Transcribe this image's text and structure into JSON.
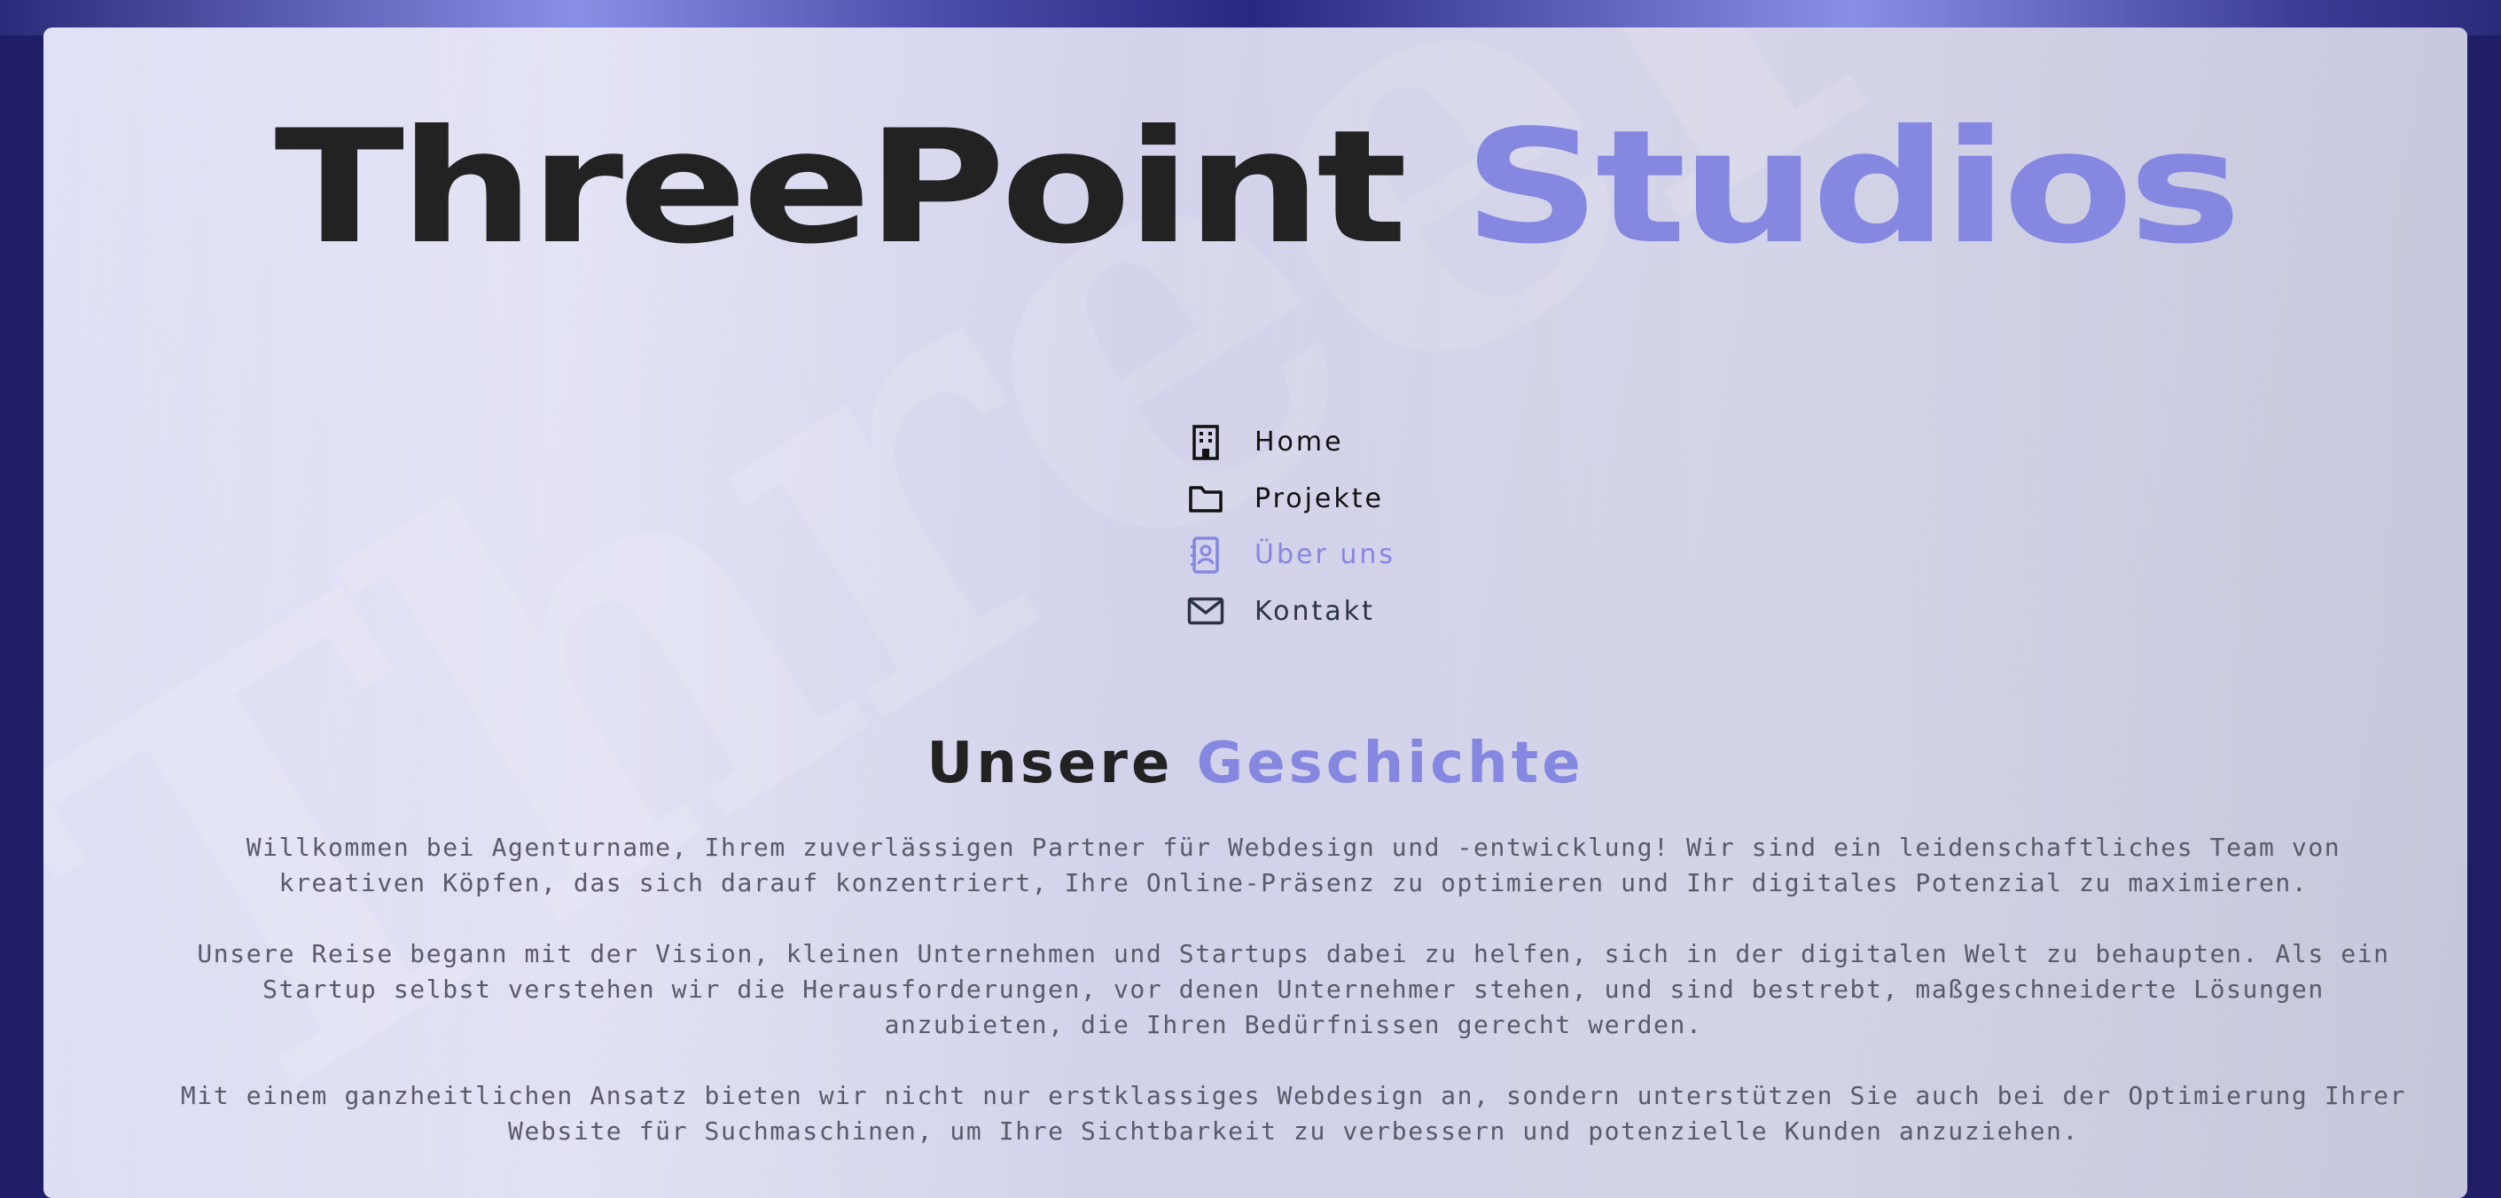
{
  "brand": {
    "name_part1": "ThreePoint",
    "name_part2": "Studios",
    "watermark": "ThreePoint"
  },
  "nav": {
    "items": [
      {
        "label": "Home",
        "icon": "building-icon"
      },
      {
        "label": "Projekte",
        "icon": "folder-icon"
      },
      {
        "label": "Über uns",
        "icon": "address-book-icon",
        "active": true
      },
      {
        "label": "Kontakt",
        "icon": "envelope-icon"
      }
    ]
  },
  "section": {
    "title_part1": "Unsere",
    "title_part2": "Geschichte",
    "paragraphs": [
      "Willkommen bei Agenturname, Ihrem zuverlässigen Partner für Webdesign und -entwicklung! Wir sind ein leidenschaftliches Team von kreativen Köpfen, das sich darauf konzentriert, Ihre Online-Präsenz zu optimieren und Ihr digitales Potenzial zu maximieren.",
      "Unsere Reise begann mit der Vision, kleinen Unternehmen und Startups dabei zu helfen, sich in der digitalen Welt zu behaupten. Als ein Startup selbst verstehen wir die Herausforderungen, vor denen Unternehmer stehen, und sind bestrebt, maßgeschneiderte Lösungen anzubieten, die Ihren Bedürfnissen gerecht werden.",
      "Mit einem ganzheitlichen Ansatz bieten wir nicht nur erstklassiges Webdesign an, sondern unterstützen Sie auch bei der Optimierung Ihrer Website für Suchmaschinen, um Ihre Sichtbarkeit zu verbessern und potenzielle Kunden anzuziehen."
    ]
  },
  "colors": {
    "accent": "#8587e0",
    "dark_text": "#222222",
    "background": "#1f1d66"
  }
}
